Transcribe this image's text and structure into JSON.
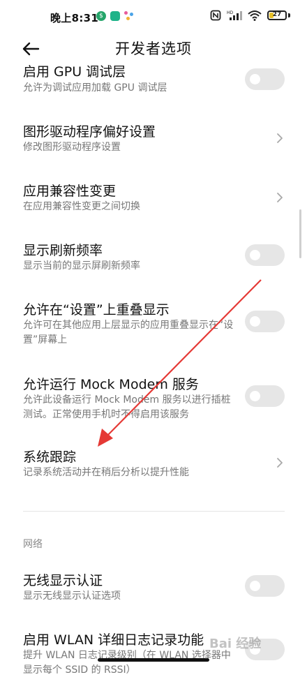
{
  "status_bar": {
    "time": "晚上8:31",
    "battery": "27",
    "battery_level": 0.27,
    "network": "HD"
  },
  "header": {
    "back_icon": "back-arrow-icon",
    "title": "开发者选项"
  },
  "items": [
    {
      "title": "启用 GPU 调试层",
      "subtitle": "允许为调试应用加载 GPU 调试层",
      "control": "toggle",
      "on": false
    },
    {
      "title": "图形驱动程序偏好设置",
      "subtitle": "修改图形驱动程序设置",
      "control": "chevron"
    },
    {
      "title": "应用兼容性变更",
      "subtitle": "在应用兼容性变更之间切换",
      "control": "chevron"
    },
    {
      "title": "显示刷新频率",
      "subtitle": "显示当前的显示屏刷新频率",
      "control": "toggle",
      "on": false
    },
    {
      "title": "允许在“设置”上重叠显示",
      "subtitle": "允许可在其他应用上层显示的应用重叠显示在“设置”屏幕上",
      "control": "toggle",
      "on": false
    },
    {
      "title": "允许运行 Mock Modem 服务",
      "subtitle": "允许此设备运行 Mock Modem 服务以进行插桩测试。正常使用手机时不得启用该服务",
      "control": "toggle",
      "on": false
    },
    {
      "title": "系统跟踪",
      "subtitle": "记录系统活动并在稍后分析以提升性能",
      "control": "chevron"
    },
    {
      "title": "无线显示认证",
      "subtitle": "显示无线显示认证选项",
      "control": "toggle",
      "on": false
    },
    {
      "title": "启用 WLAN 详细日志记录功能",
      "subtitle": "提升 WLAN 日志记录级别（在 WLAN 选择器中显示每个 SSID 的 RSSI）",
      "control": "toggle",
      "on": false
    }
  ],
  "section": {
    "label": "网络"
  },
  "watermark": "Bai 经验",
  "colors": {
    "toggle_off": "#e6e6e6",
    "annotation_arrow": "#e53935",
    "subtitle": "#777777"
  }
}
